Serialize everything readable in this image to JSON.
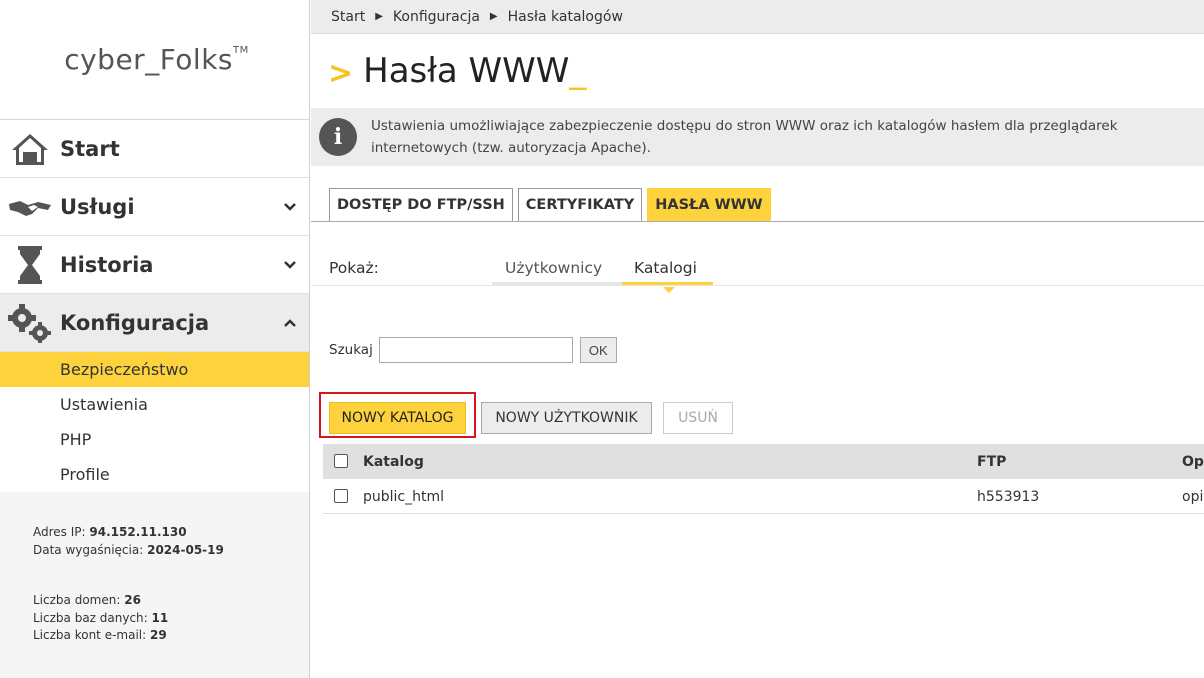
{
  "brand": {
    "logo": "cyber_Folks",
    "tm": "TM"
  },
  "nav": {
    "start": "Start",
    "services": "Usługi",
    "history": "Historia",
    "config": "Konfiguracja",
    "sub": [
      "Bezpieczeństwo",
      "Ustawienia",
      "PHP",
      "Profile"
    ]
  },
  "account": {
    "ip_label": "Adres IP:",
    "ip": "94.152.11.130",
    "expiry_label": "Data wygaśnięcia:",
    "expiry": "2024-05-19",
    "domains_label": "Liczba domen:",
    "domains": "26",
    "databases_label": "Liczba baz danych:",
    "databases": "11",
    "emails_label": "Liczba kont e-mail:",
    "emails": "29"
  },
  "breadcrumb": [
    "Start",
    "Konfiguracja",
    "Hasła katalogów"
  ],
  "page": {
    "arrow": ">",
    "title": "Hasła WWW",
    "cursor": "_",
    "info": "Ustawienia umożliwiające zabezpieczenie dostępu do stron WWW oraz ich katalogów hasłem dla przeglądarek internetowych (tzw. autoryzacja Apache)."
  },
  "tabs": [
    "DOSTĘP DO FTP/SSH",
    "CERTYFIKATY",
    "HASŁA WWW"
  ],
  "show": {
    "label": "Pokaż:",
    "users": "Użytkownicy",
    "catalogs": "Katalogi"
  },
  "search": {
    "label": "Szukaj",
    "value": "",
    "ok": "OK"
  },
  "actions": {
    "new_catalog": "NOWY KATALOG",
    "new_user": "NOWY UŻYTKOWNIK",
    "delete": "USUŃ"
  },
  "table": {
    "headers": {
      "name": "Katalog",
      "ftp": "FTP",
      "opt": "Op"
    },
    "rows": [
      {
        "name": "public_html",
        "ftp": "h553913",
        "opt": "opi"
      }
    ]
  },
  "colors": {
    "accent": "#fdd23d",
    "highlight": "#d9141c",
    "sidebar_bg": "#f5f5f5"
  }
}
